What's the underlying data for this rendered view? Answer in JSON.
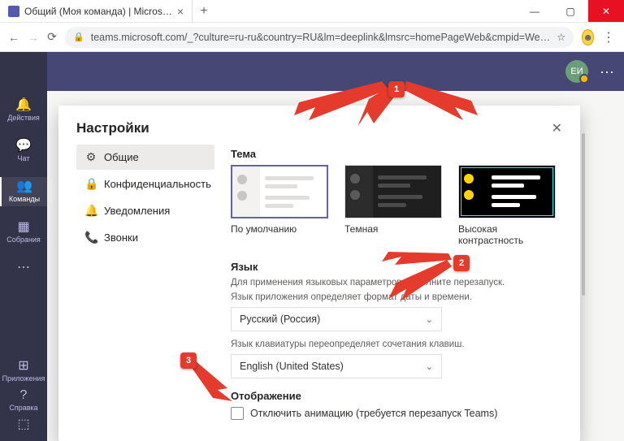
{
  "browser": {
    "tab_title": "Общий (Моя команда) | Micros…",
    "url": "teams.microsoft.com/_?culture=ru-ru&country=RU&lm=deeplink&lmsrc=homePageWeb&cmpid=We…",
    "star": "☆",
    "profile_emoji": "☻",
    "menu": "⋮",
    "back": "←",
    "fwd": "→",
    "reload": "⟳",
    "newtab": "+",
    "tab_close": "×",
    "win_min": "—",
    "win_max": "▢",
    "win_close": "✕",
    "lock": "🔒"
  },
  "teams": {
    "avatar_initials": "ЕИ",
    "dots": "···"
  },
  "rail": {
    "items": [
      {
        "icon": "🔔",
        "label": "Действия"
      },
      {
        "icon": "💬",
        "label": "Чат"
      },
      {
        "icon": "👥",
        "label": "Команды"
      },
      {
        "icon": "▦",
        "label": "Собрания"
      },
      {
        "icon": "⋯",
        "label": ""
      }
    ],
    "bottom": [
      {
        "icon": "⊞",
        "label": "Приложения"
      },
      {
        "icon": "?",
        "label": "Справка"
      },
      {
        "icon": "⬚",
        "label": ""
      }
    ]
  },
  "modal": {
    "title": "Настройки",
    "close": "✕",
    "side": [
      {
        "icon": "⚙",
        "label": "Общие"
      },
      {
        "icon": "🔒",
        "label": "Конфиденциальность"
      },
      {
        "icon": "🔔",
        "label": "Уведомления"
      },
      {
        "icon": "📞",
        "label": "Звонки"
      }
    ],
    "theme_section": "Тема",
    "themes": [
      {
        "label": "По умолчанию"
      },
      {
        "label": "Темная"
      },
      {
        "label": "Высокая контрастность"
      }
    ],
    "lang_section": "Язык",
    "lang_hint1": "Для применения языковых параметров выполните перезапуск.",
    "lang_hint2": "Язык приложения определяет формат даты и времени.",
    "lang_select1": "Русский (Россия)",
    "lang_hint3": "Язык клавиатуры переопределяет сочетания клавиш.",
    "lang_select2": "English (United States)",
    "display_section": "Отображение",
    "display_check": "Отключить анимацию (требуется перезапуск Teams)",
    "chev": "⌄"
  },
  "callouts": {
    "c1": "1",
    "c2": "2",
    "c3": "3"
  }
}
